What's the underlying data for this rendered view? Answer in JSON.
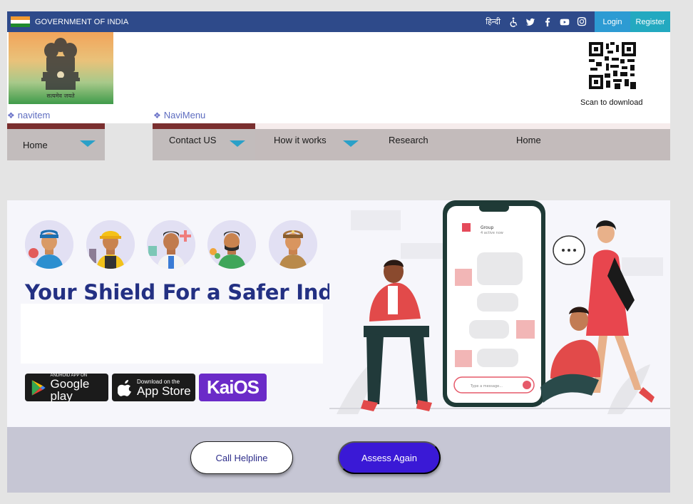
{
  "govbar": {
    "title": "GOVERNMENT OF INDIA",
    "hindi": "हिन्दी",
    "login": "Login",
    "register": "Register",
    "icons": [
      "accessibility-icon",
      "twitter-icon",
      "facebook-icon",
      "youtube-icon",
      "instagram-icon"
    ]
  },
  "header": {
    "emblem_caption": "सत्यमेव जयते",
    "qr_caption": "Scan to download"
  },
  "nav": {
    "label_left": "navitem",
    "label_right": "NaviMenu",
    "items": [
      "Home",
      "Contact US",
      "How it works",
      "Research",
      "Home"
    ]
  },
  "banner": {
    "headline": "Your Shield For a Safer India",
    "phone_group": "Group",
    "phone_status": "4 active now",
    "phone_input": "Type a message...",
    "stores": {
      "google_small": "ANDROID APP ON",
      "google_big": "Google play",
      "apple_small": "Download on the",
      "apple_big": "App Store",
      "kai": "KaiOS"
    }
  },
  "actions": {
    "call": "Call Helpline",
    "assess": "Assess Again"
  },
  "colors": {
    "govbar": "#2e4a8a",
    "login": "#2d9bd3",
    "register": "#23a9c0",
    "headline": "#233083",
    "assess_button": "#3a19d6",
    "nav_accent": "#7a2f2f",
    "caret": "#2aa0c8"
  }
}
